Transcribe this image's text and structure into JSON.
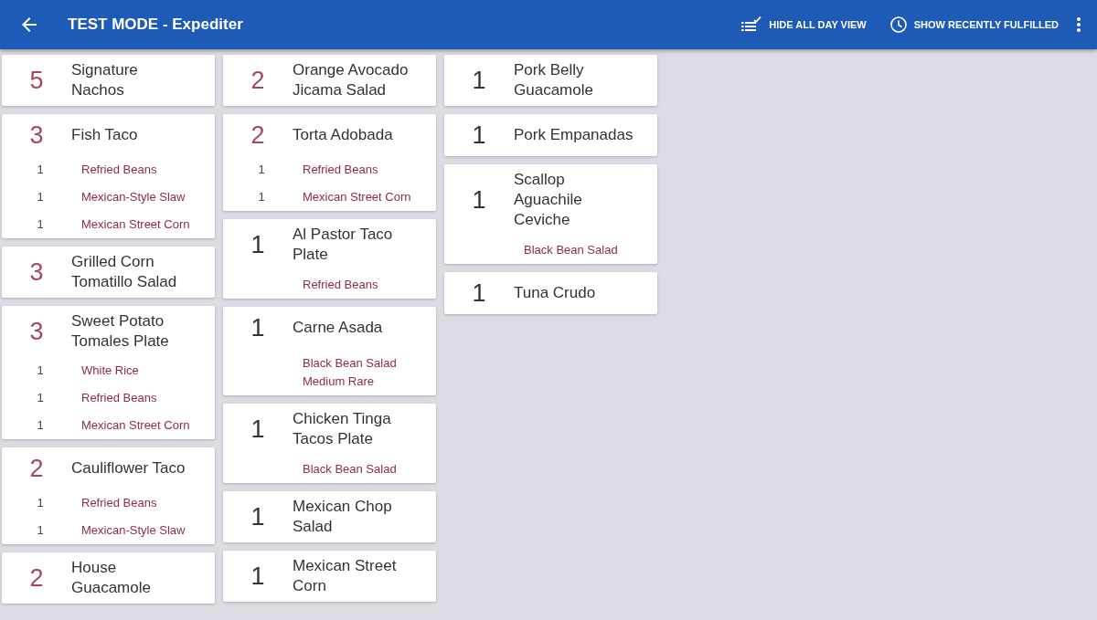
{
  "app_bar": {
    "title": "TEST MODE - Expediter",
    "actions": [
      {
        "kind": "view",
        "label": "HIDE ALL DAY VIEW"
      },
      {
        "kind": "history",
        "label": "SHOW RECENTLY FULFILLED"
      }
    ]
  },
  "columns": [
    {
      "items": [
        {
          "count": "5",
          "highlighted": true,
          "name": "Signature\nNachos"
        },
        {
          "count": "3",
          "highlighted": true,
          "name": "Fish Taco",
          "modifiers": [
            {
              "count": "1",
              "name": "Refried Beans"
            },
            {
              "count": "1",
              "name": "Mexican-Style Slaw"
            },
            {
              "count": "1",
              "name": "Mexican Street Corn"
            }
          ]
        },
        {
          "count": "3",
          "highlighted": true,
          "name": "Grilled Corn\nTomatillo Salad"
        },
        {
          "count": "3",
          "highlighted": true,
          "name": "Sweet Potato\nTomales Plate",
          "modifiers": [
            {
              "count": "1",
              "name": "White Rice"
            },
            {
              "count": "1",
              "name": "Refried Beans"
            },
            {
              "count": "1",
              "name": "Mexican Street Corn"
            }
          ]
        },
        {
          "count": "2",
          "highlighted": true,
          "name": "Cauliflower Taco",
          "modifiers": [
            {
              "count": "1",
              "name": "Refried Beans"
            },
            {
              "count": "1",
              "name": "Mexican-Style Slaw"
            }
          ]
        },
        {
          "count": "2",
          "highlighted": true,
          "name": "House\nGuacamole"
        }
      ]
    },
    {
      "items": [
        {
          "count": "2",
          "highlighted": true,
          "name": "Orange Avocado\nJicama Salad"
        },
        {
          "count": "2",
          "highlighted": true,
          "name": "Torta Adobada",
          "modifiers": [
            {
              "count": "1",
              "name": "Refried Beans"
            },
            {
              "count": "1",
              "name": "Mexican Street Corn"
            }
          ]
        },
        {
          "count": "1",
          "highlighted": false,
          "name": "Al Pastor Taco\nPlate",
          "notes": [
            "Refried Beans"
          ]
        },
        {
          "count": "1",
          "highlighted": false,
          "name": "Carne Asada",
          "notes": [
            "Black Bean Salad",
            "Medium Rare"
          ]
        },
        {
          "count": "1",
          "highlighted": false,
          "name": "Chicken Tinga\nTacos Plate",
          "notes": [
            "Black Bean Salad"
          ]
        },
        {
          "count": "1",
          "highlighted": false,
          "name": "Mexican Chop\nSalad"
        },
        {
          "count": "1",
          "highlighted": false,
          "name": "Mexican Street\nCorn"
        }
      ]
    },
    {
      "items": [
        {
          "count": "1",
          "highlighted": false,
          "name": "Pork Belly\nGuacamole"
        },
        {
          "count": "1",
          "highlighted": false,
          "name": "Pork Empanadas"
        },
        {
          "count": "1",
          "highlighted": false,
          "name": "Scallop\nAguachile\nCeviche",
          "notes": [
            "Black Bean Salad"
          ]
        },
        {
          "count": "1",
          "highlighted": false,
          "name": "Tuna Crudo"
        }
      ]
    }
  ]
}
